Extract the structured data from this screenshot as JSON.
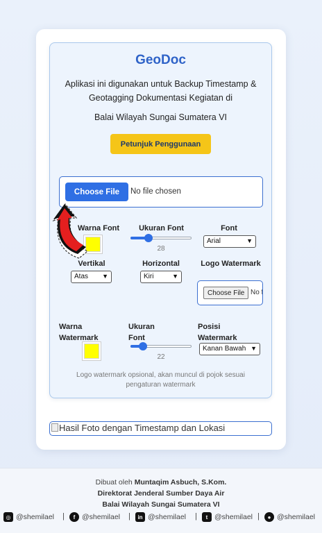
{
  "app": {
    "title": "GeoDoc",
    "description": "Aplikasi ini digunakan untuk Backup Timestamp & Geotagging Dokumentasi Kegiatan di",
    "location": "Balai Wilayah Sungai Sumatera VI",
    "guide_button": "Petunjuk Penggunaan"
  },
  "upload": {
    "button": "Choose File",
    "status": "No file chosen"
  },
  "settings": {
    "font_color_label": "Warna Font",
    "font_color": "#ffff00",
    "font_size_label": "Ukuran Font",
    "font_size_value": "28",
    "font_size_fraction": 0.3,
    "font_label": "Font",
    "font_value": "Arial",
    "vertical_label": "Vertikal",
    "vertical_value": "Atas",
    "horizontal_label": "Horizontal",
    "horizontal_value": "Kiri",
    "logo_label": "Logo Watermark",
    "logo_button": "Choose File",
    "logo_status": "No file chosen",
    "wm_color_label_1": "Warna",
    "wm_color_label_2": "Watermark",
    "wm_color": "#ffff00",
    "wm_size_label_1": "Ukuran",
    "wm_size_label_2": "Font",
    "wm_size_value": "22",
    "wm_size_fraction": 0.2,
    "wm_pos_label_1": "Posisi",
    "wm_pos_label_2": "Watermark",
    "wm_pos_value": "Kanan Bawah",
    "note": "Logo watermark opsional, akan muncul di pojok sesuai pengaturan watermark"
  },
  "result": {
    "alt": "Hasil Foto dengan Timestamp dan Lokasi"
  },
  "footer": {
    "made_by_prefix": "Dibuat oleh",
    "author": "Muntaqim Asbuch, S.Kom.",
    "org": "Direktorat Jenderal Sumber Daya Air",
    "unit": "Balai Wilayah Sungai Sumatera VI",
    "socials": [
      {
        "icon": "instagram-icon",
        "handle": "@shemilael"
      },
      {
        "icon": "facebook-icon",
        "handle": "@shemilael"
      },
      {
        "icon": "linkedin-icon",
        "handle": "@shemilael"
      },
      {
        "icon": "twitter-icon",
        "handle": "@shemilael"
      },
      {
        "icon": "github-icon",
        "handle": "@shemilael"
      }
    ]
  },
  "colors": {
    "accent": "#2f6fe4",
    "title": "#2f63c8",
    "guide_button": "#f5c518"
  }
}
